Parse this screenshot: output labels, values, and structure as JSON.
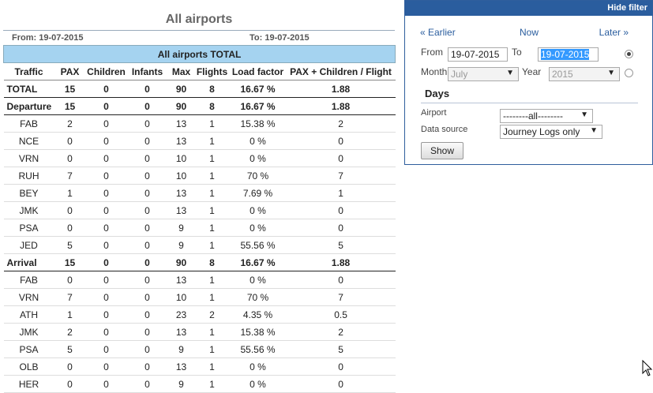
{
  "report": {
    "title": "All airports",
    "from_label": "From: 19-07-2015",
    "to_label": "To: 19-07-2015",
    "table_caption": "All airports TOTAL",
    "columns": [
      "Traffic",
      "PAX",
      "Children",
      "Infants",
      "Max",
      "Flights",
      "Load factor",
      "PAX + Children / Flight"
    ],
    "total": [
      "TOTAL",
      "15",
      "0",
      "0",
      "90",
      "8",
      "16.67 %",
      "1.88"
    ],
    "departure": [
      "Departure",
      "15",
      "0",
      "0",
      "90",
      "8",
      "16.67 %",
      "1.88"
    ],
    "departure_rows": [
      [
        "FAB",
        "2",
        "0",
        "0",
        "13",
        "1",
        "15.38 %",
        "2"
      ],
      [
        "NCE",
        "0",
        "0",
        "0",
        "13",
        "1",
        "0 %",
        "0"
      ],
      [
        "VRN",
        "0",
        "0",
        "0",
        "10",
        "1",
        "0 %",
        "0"
      ],
      [
        "RUH",
        "7",
        "0",
        "0",
        "10",
        "1",
        "70 %",
        "7"
      ],
      [
        "BEY",
        "1",
        "0",
        "0",
        "13",
        "1",
        "7.69 %",
        "1"
      ],
      [
        "JMK",
        "0",
        "0",
        "0",
        "13",
        "1",
        "0 %",
        "0"
      ],
      [
        "PSA",
        "0",
        "0",
        "0",
        "9",
        "1",
        "0 %",
        "0"
      ],
      [
        "JED",
        "5",
        "0",
        "0",
        "9",
        "1",
        "55.56 %",
        "5"
      ]
    ],
    "arrival": [
      "Arrival",
      "15",
      "0",
      "0",
      "90",
      "8",
      "16.67 %",
      "1.88"
    ],
    "arrival_rows": [
      [
        "FAB",
        "0",
        "0",
        "0",
        "13",
        "1",
        "0 %",
        "0"
      ],
      [
        "VRN",
        "7",
        "0",
        "0",
        "10",
        "1",
        "70 %",
        "7"
      ],
      [
        "ATH",
        "1",
        "0",
        "0",
        "23",
        "2",
        "4.35 %",
        "0.5"
      ],
      [
        "JMK",
        "2",
        "0",
        "0",
        "13",
        "1",
        "15.38 %",
        "2"
      ],
      [
        "PSA",
        "5",
        "0",
        "0",
        "9",
        "1",
        "55.56 %",
        "5"
      ],
      [
        "OLB",
        "0",
        "0",
        "0",
        "13",
        "1",
        "0 %",
        "0"
      ],
      [
        "HER",
        "0",
        "0",
        "0",
        "9",
        "1",
        "0 %",
        "0"
      ]
    ]
  },
  "filter": {
    "hide_label": "Hide filter",
    "earlier": "« Earlier",
    "now": "Now",
    "later": "Later »",
    "from_label": "From",
    "from_value": "19-07-2015",
    "to_label": "To",
    "to_value": "19-07-2015",
    "month_label": "Month",
    "month_value": "July",
    "year_label": "Year",
    "year_value": "2015",
    "days_label": "Days",
    "airport_label": "Airport",
    "airport_value": "--------all--------",
    "source_label": "Data source",
    "source_value": "Journey Logs only",
    "show_label": "Show"
  },
  "colors": {
    "header_bar": "#2a5d9e",
    "caption_bg": "#a5d3f0",
    "link": "#2a5d9e"
  }
}
